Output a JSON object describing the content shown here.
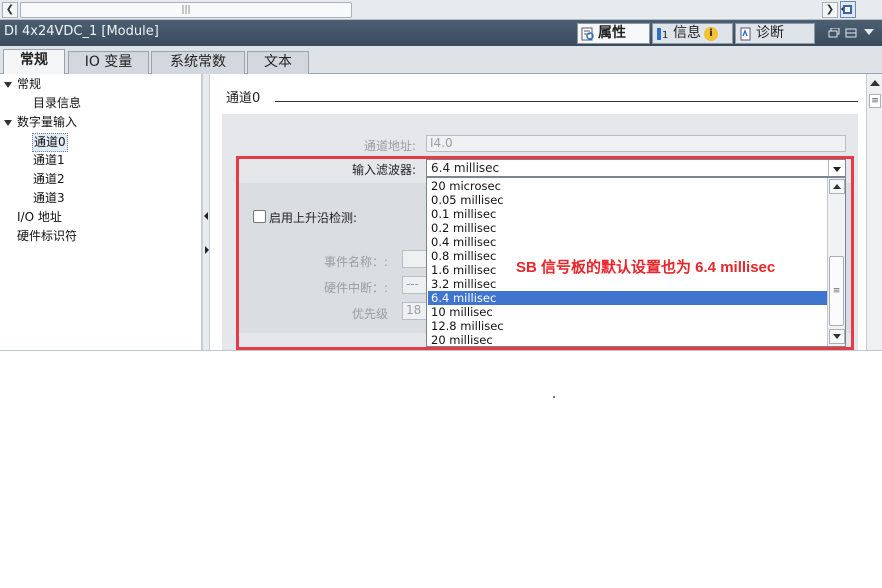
{
  "top_scroll": {
    "thumb_grip": "|||"
  },
  "window": {
    "title": "DI 4x24VDC_1 [Module]",
    "panel_tabs": [
      {
        "label": "属性",
        "icon": "properties-icon",
        "active": true
      },
      {
        "label": "信息",
        "icon": "info-icon",
        "active": false
      },
      {
        "label": "诊断",
        "icon": "diagnostics-icon",
        "active": false
      }
    ],
    "info_badge": "i"
  },
  "tabs": [
    {
      "label": "常规",
      "active": true
    },
    {
      "label": "IO 变量",
      "active": false
    },
    {
      "label": "系统常数",
      "active": false
    },
    {
      "label": "文本",
      "active": false
    }
  ],
  "tree": {
    "items": [
      {
        "label": "常规",
        "level": 0,
        "expanded": true
      },
      {
        "label": "目录信息",
        "level": 1
      },
      {
        "label": "数字量输入",
        "level": 0,
        "expanded": true
      },
      {
        "label": "通道0",
        "level": 1,
        "selected": true
      },
      {
        "label": "通道1",
        "level": 1
      },
      {
        "label": "通道2",
        "level": 1
      },
      {
        "label": "通道3",
        "level": 1
      },
      {
        "label": "I/O 地址",
        "level": 0
      },
      {
        "label": "硬件标识符",
        "level": 0
      }
    ]
  },
  "main": {
    "section_title": "通道0",
    "channel_address_label": "通道地址:",
    "channel_address_value": "I4.0",
    "filter_label": "输入滤波器:",
    "filter_value": "6.4 millisec",
    "filter_options": [
      "20 microsec",
      "0.05 millisec",
      "0.1 millisec",
      "0.2 millisec",
      "0.4 millisec",
      "0.8 millisec",
      "1.6 millisec",
      "3.2 millisec",
      "6.4 millisec",
      "10 millisec",
      "12.8 millisec",
      "20 millisec"
    ],
    "selected_option_index": 8,
    "rising_edge_label": "启用上升沿检测:",
    "event_name_label": "事件名称：:",
    "hw_interrupt_label": "硬件中断：:",
    "hw_interrupt_value": "---",
    "priority_label": "优先级",
    "priority_value": "18",
    "annotation": "SB 信号板的默认设置也为 6.4 millisec"
  },
  "colors": {
    "title_bar": "#3f5163",
    "selection": "#3f75cf",
    "highlight_red": "#e53a48",
    "annotation_red": "#e8262c"
  }
}
